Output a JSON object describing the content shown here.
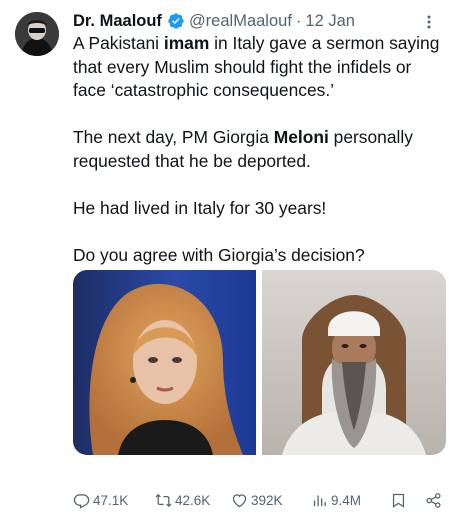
{
  "tweet": {
    "author": "Dr. Maalouf",
    "handle": "@realMaalouf",
    "separator": "·",
    "date": "12 Jan",
    "paragraphs": [
      [
        {
          "t": "A Pakistani "
        },
        {
          "t": "imam",
          "b": true
        },
        {
          "t": " in Italy gave a sermon saying that every Muslim should fight the infidels or face ‘catastrophic consequences.’"
        }
      ],
      [
        {
          "t": "The next day, PM Giorgia "
        },
        {
          "t": "Meloni",
          "b": true
        },
        {
          "t": " personally requested that he be deported."
        }
      ],
      [
        {
          "t": "He had lived in Italy for 30 years!"
        }
      ],
      [
        {
          "t": "Do you agree with Giorgia’s decision?"
        }
      ]
    ]
  },
  "stats": {
    "replies": "47.1K",
    "reposts": "42.6K",
    "likes": "392K",
    "views": "9.4M"
  },
  "icons": {
    "verified": "verified-badge-icon",
    "more": "more-dots-icon",
    "reply": "reply-icon",
    "repost": "repost-icon",
    "like": "heart-icon",
    "views": "views-icon",
    "bookmark": "bookmark-icon",
    "share": "share-icon"
  },
  "colors": {
    "verified": "#1d9bf0",
    "text": "#0f1419",
    "muted": "#536471"
  }
}
